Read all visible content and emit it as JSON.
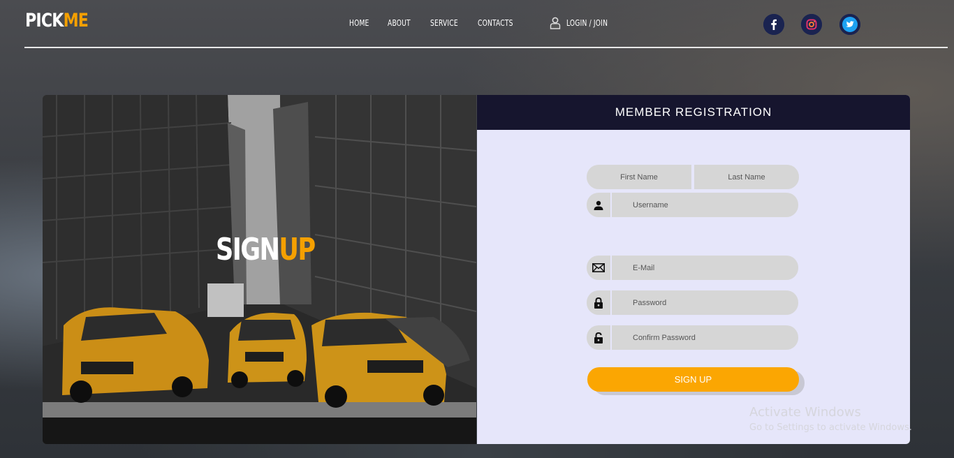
{
  "brand": {
    "part1": "PICK",
    "part2": "ME"
  },
  "nav": {
    "items": [
      {
        "label": "HOME"
      },
      {
        "label": "ABOUT"
      },
      {
        "label": "SERVICE"
      },
      {
        "label": "CONTACTS"
      },
      {
        "label": "LOGIN / JOIN"
      }
    ]
  },
  "social": {
    "facebook": "f",
    "instagram": "instagram-icon",
    "twitter": "twitter-icon"
  },
  "hero": {
    "word1": "SIGN",
    "word2": "UP"
  },
  "form": {
    "title": "MEMBER REGISTRATION",
    "first_name_placeholder": "First Name",
    "last_name_placeholder": "Last Name",
    "username_placeholder": "Username",
    "email_placeholder": "E-Mail",
    "password_placeholder": "Password",
    "confirm_password_placeholder": "Confirm Password",
    "submit_label": "SIGN UP"
  },
  "watermark": {
    "line1": "Activate Windows",
    "line2": "Go to Settings to activate Windows."
  },
  "colors": {
    "accent": "#f5a000",
    "header": "#16152e",
    "panel": "#e6e6fa",
    "field": "#d6d6d6"
  }
}
